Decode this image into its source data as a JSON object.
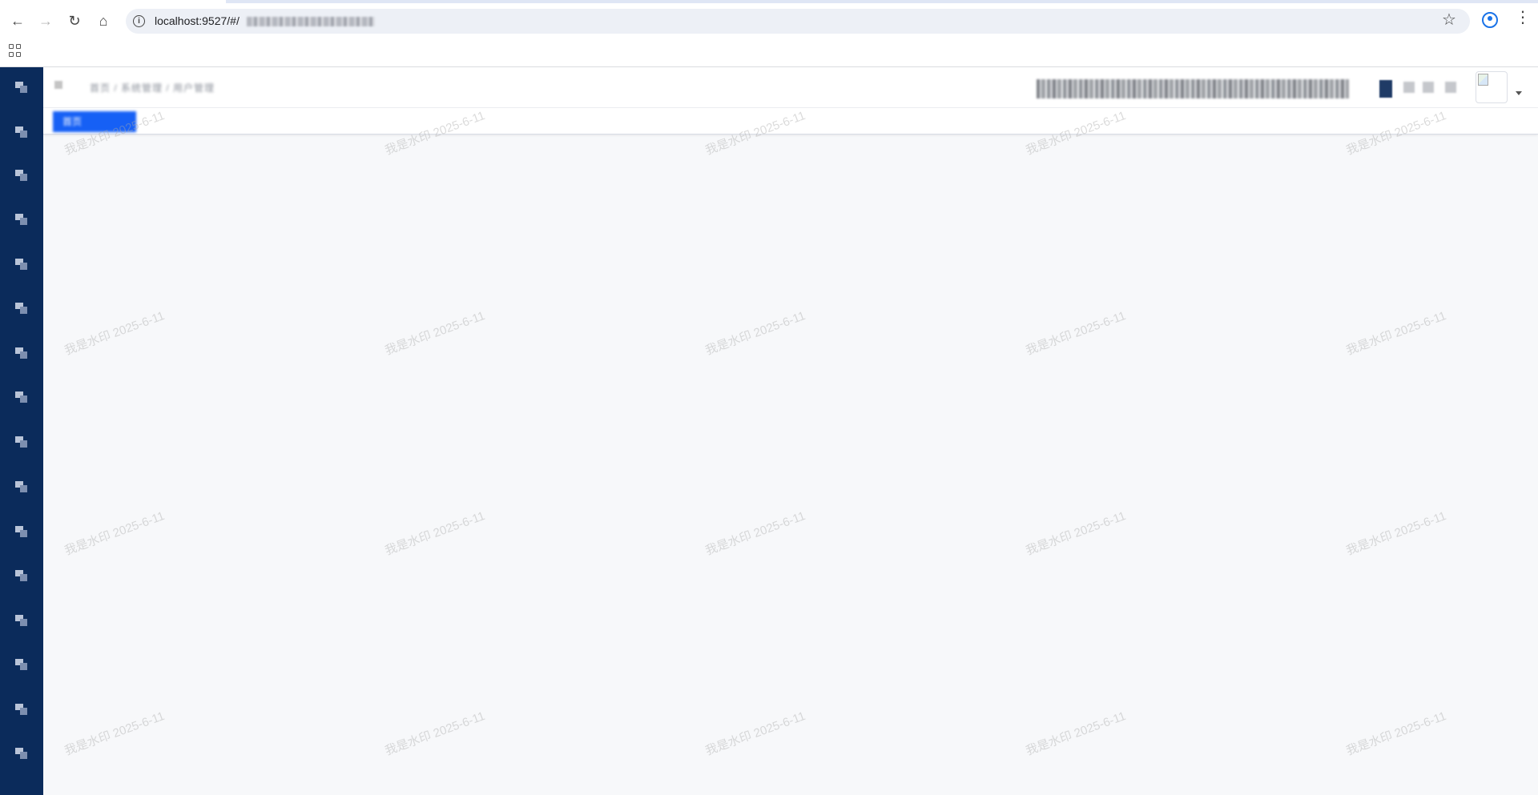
{
  "browser": {
    "url_prefix": "localhost:9527/#/",
    "back_icon": "arrow-left-icon",
    "forward_icon": "arrow-right-icon",
    "reload_icon": "reload-icon",
    "home_icon": "home-icon",
    "site_info_icon": "info-icon",
    "bookmark_icon": "star-icon",
    "profile_icon": "profile-icon",
    "menu_icon": "more-vert-icon",
    "apps_icon": "apps-grid-icon"
  },
  "navbar": {
    "breadcrumb": "首页 / 系统管理 / 用户管理",
    "right_info": "",
    "avatar_icon": "avatar-image-icon"
  },
  "tags": {
    "active_tag": "首页"
  },
  "watermark": {
    "text": "我是水印 2025-6-11"
  },
  "footer": {
    "text": ""
  },
  "sidebar": {
    "item_count_hint": "16",
    "accent": "#0b2b5b"
  },
  "colors": {
    "tag_active": "#1660f5",
    "page_bg": "#f7f8fa",
    "profile_accent": "#1a73e8"
  }
}
